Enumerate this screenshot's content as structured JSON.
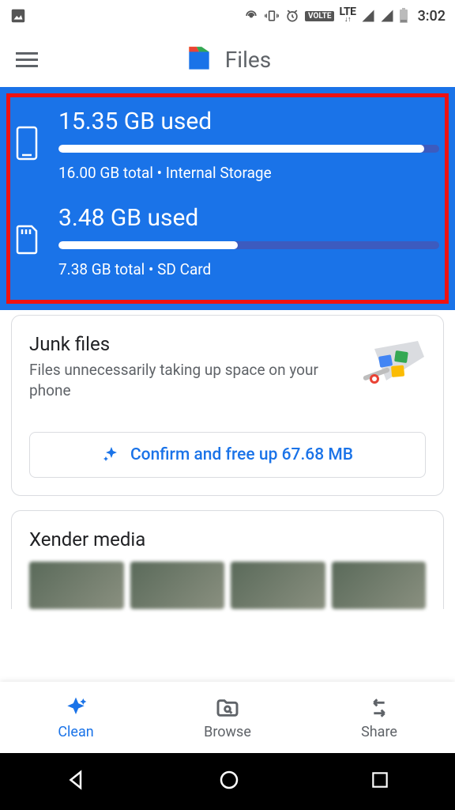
{
  "status": {
    "time": "3:02",
    "volte": "VOLTE",
    "lte": "LTE"
  },
  "app": {
    "title": "Files"
  },
  "storage": [
    {
      "icon": "phone",
      "used_text": "15.35 GB used",
      "percent": 96,
      "sub": "16.00 GB total • Internal Storage"
    },
    {
      "icon": "sd",
      "used_text": "3.48 GB used",
      "percent": 47,
      "sub": "7.38 GB total • SD Card"
    }
  ],
  "junk": {
    "title": "Junk files",
    "subtitle": "Files unnecessarily taking up space on your phone",
    "button": "Confirm and free up 67.68 MB"
  },
  "xender": {
    "title": "Xender media"
  },
  "nav": {
    "clean": "Clean",
    "browse": "Browse",
    "share": "Share"
  }
}
